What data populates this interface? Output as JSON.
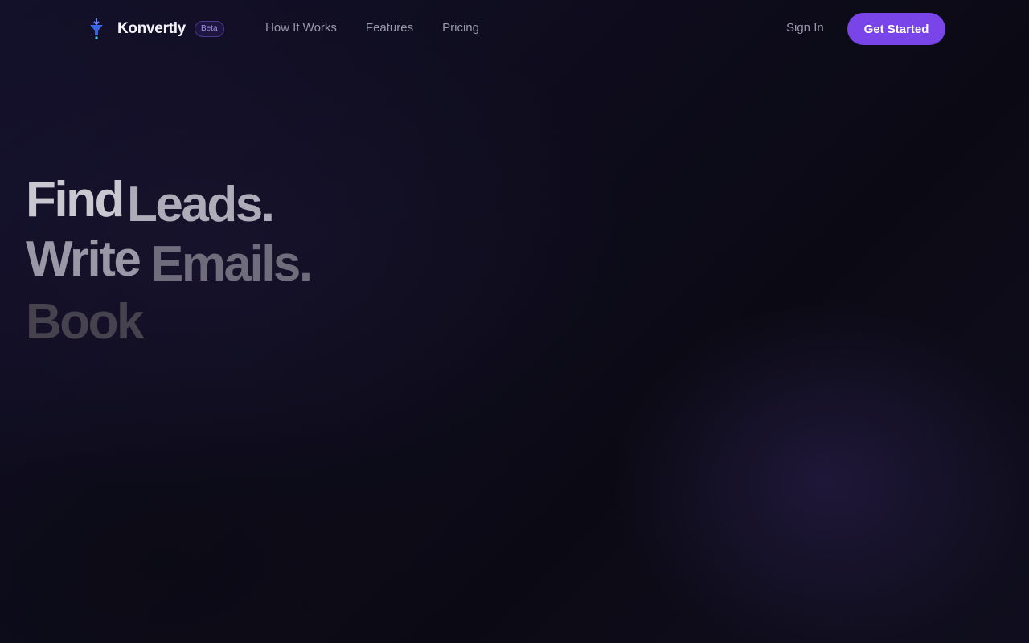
{
  "brand": {
    "name": "Konvertly",
    "badge": "Beta",
    "logo_icon": "funnel-arrow-icon",
    "accent": "#7a45e8"
  },
  "nav": {
    "links": [
      "How It Works",
      "Features",
      "Pricing"
    ],
    "sign_in": "Sign In",
    "cta": "Get Started"
  },
  "hero": {
    "lines": [
      {
        "verb": "Find",
        "object": "Leads."
      },
      {
        "verb": "Write",
        "object": "Emails."
      },
      {
        "verb": "Book",
        "object": ""
      }
    ]
  }
}
